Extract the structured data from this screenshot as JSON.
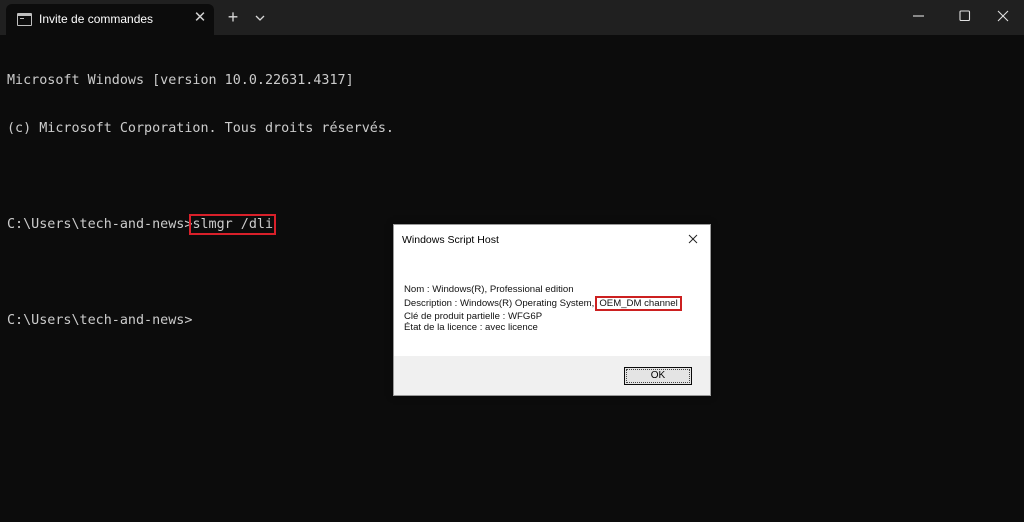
{
  "tab": {
    "title": "Invite de commandes",
    "icon": "terminal-icon"
  },
  "window_controls": {
    "minimize_icon": "minimize-icon",
    "maximize_icon": "maximize-icon",
    "close_icon": "close-icon"
  },
  "terminal": {
    "line1": "Microsoft Windows [version 10.0.22631.4317]",
    "line2": "(c) Microsoft Corporation. Tous droits réservés.",
    "prompt1": "C:\\Users\\tech-and-news>",
    "command": "slmgr /dli",
    "prompt2": "C:\\Users\\tech-and-news>"
  },
  "dialog": {
    "title": "Windows Script Host",
    "name_line": "Nom : Windows(R), Professional edition",
    "description_prefix": "Description : Windows(R) Operating System,",
    "description_highlight": "OEM_DM channel",
    "partial_key_line": "Clé de produit partielle : WFG6P",
    "license_state_line": "État de la licence : avec licence",
    "ok_label": "OK"
  },
  "colors": {
    "highlight": "#d9202a",
    "terminal_bg": "#0c0c0c",
    "titlebar_bg": "#202020"
  }
}
